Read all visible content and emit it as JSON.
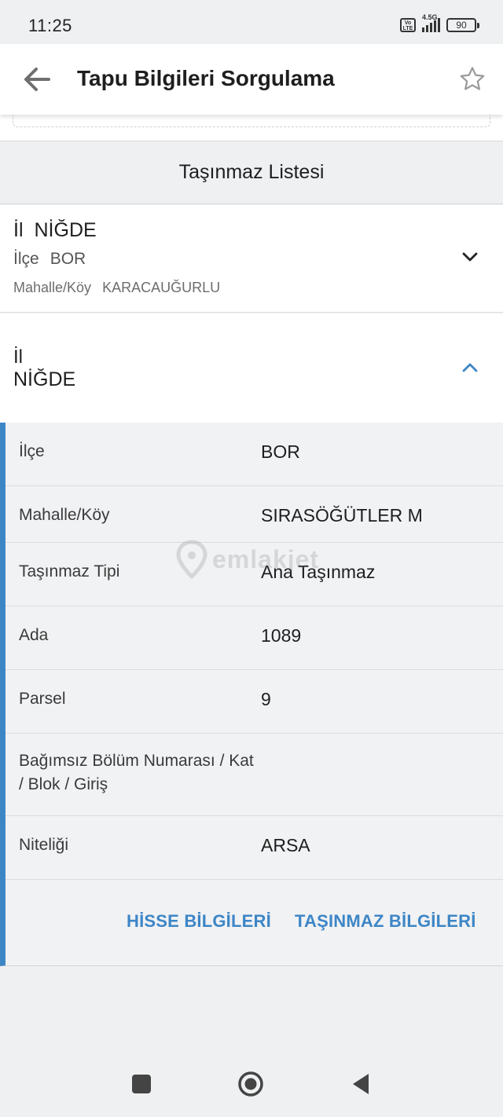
{
  "status_bar": {
    "time": "11:25",
    "network": "4.5G",
    "volte": "Vo LTE",
    "battery": "90"
  },
  "header": {
    "title": "Tapu Bilgileri Sorgulama",
    "back_icon": "arrow-left-icon",
    "favorite_icon": "star-outline-icon"
  },
  "section_title": "Taşınmaz Listesi",
  "collapsed_item": {
    "il_label": "İl",
    "il_value": "NİĞDE",
    "ilce_label": "İlçe",
    "ilce_value": "BOR",
    "mahalle_label": "Mahalle/Köy",
    "mahalle_value": "KARACAUĞURLU",
    "chevron_icon": "chevron-down-icon"
  },
  "expanded_item": {
    "il_label": "İl",
    "il_value": "NİĞDE",
    "chevron_icon": "chevron-up-icon",
    "rows": [
      {
        "label": "İlçe",
        "value": "BOR"
      },
      {
        "label": "Mahalle/Köy",
        "value": "SIRASÖĞÜTLER M"
      },
      {
        "label": "Taşınmaz Tipi",
        "value": "Ana Taşınmaz"
      },
      {
        "label": "Ada",
        "value": "1089"
      },
      {
        "label": "Parsel",
        "value": "9"
      },
      {
        "label": "Bağımsız Bölüm Numarası / Kat / Blok / Giriş",
        "value": ""
      },
      {
        "label": "Niteliği",
        "value": "ARSA"
      }
    ],
    "actions": {
      "hisse": "HİSSE BİLGİLERİ",
      "tasinmaz": "TAŞINMAZ BİLGİLERİ"
    }
  },
  "watermark": "emlakjet",
  "colors": {
    "accent": "#3d86c6",
    "background": "#eef0f2",
    "card": "#ffffff"
  },
  "nav": {
    "recents_icon": "square-icon",
    "home_icon": "circle-icon",
    "back_icon": "triangle-back-icon"
  }
}
